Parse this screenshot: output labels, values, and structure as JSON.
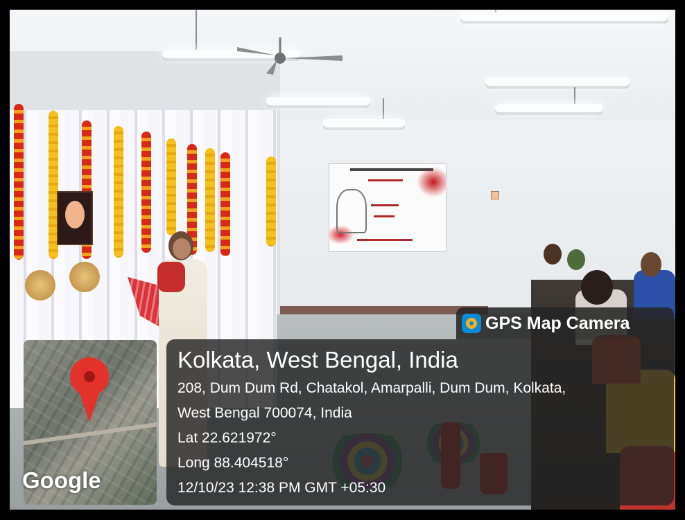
{
  "app": {
    "watermark_brand": "GPS Map Camera",
    "icon": "gps-map-camera-icon"
  },
  "location": {
    "title": "Kolkata, West Bengal, India",
    "address_line1": "208, Dum Dum Rd, Chatakol, Amarpalli, Dum Dum, Kolkata,",
    "address_line2": "West Bengal 700074, India",
    "latitude": "Lat 22.621972°",
    "longitude": "Long 88.404518°",
    "timestamp": "12/10/23 12:38 PM GMT +05:30"
  },
  "map": {
    "attribution": "Google",
    "marker_icon": "map-pin-icon"
  },
  "colors": {
    "overlay_bg": "#242424",
    "pin": "#e3312b",
    "app_icon": "#0b8bd6"
  }
}
